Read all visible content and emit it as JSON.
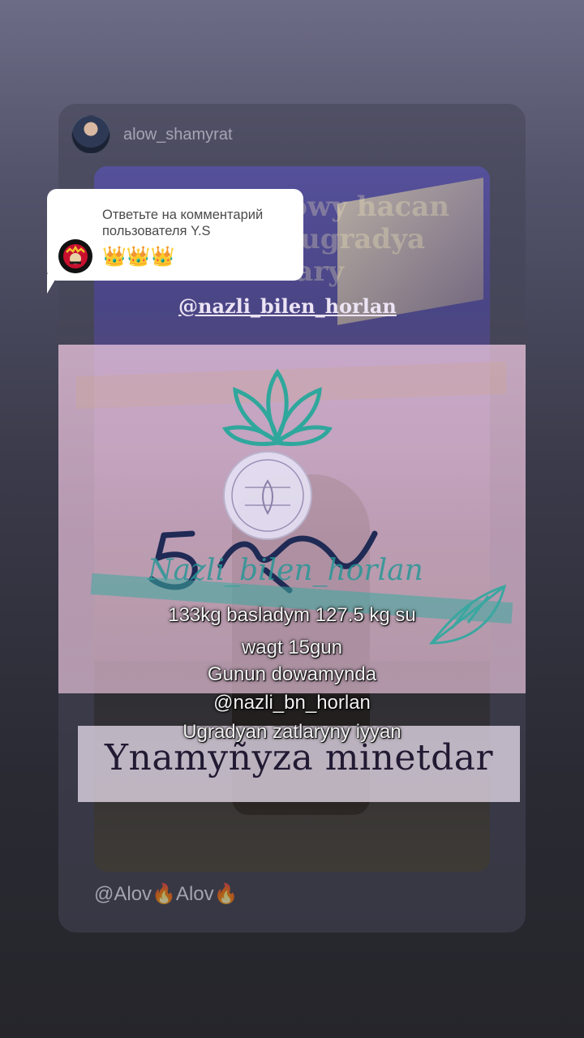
{
  "post": {
    "username": "alow_shamyrat",
    "footer": "@Alov🔥Alov🔥"
  },
  "reply_bubble": {
    "title": "Ответьте на комментарий пользователя Y.S",
    "comment": "👑👑👑"
  },
  "video": {
    "top_lines": [
      "owy hacan",
      "ugradya",
      "ary"
    ],
    "top_handle": "@nazli_bilen_horlan",
    "bag_brand": "Nazli_bilen_horlan",
    "captions": [
      "133kg basladym 127.5 kg su",
      "wagt 15gun",
      "Gunun dowamynda",
      "@nazli_bn_horlan",
      "Ugradyan zatlaryny iyyan"
    ],
    "banner": "Ynamyñyza minetdar"
  },
  "colors": {
    "accent_teal": "#3aa7a0",
    "bag_pink": "#f0c6df",
    "banner_text": "#221a33"
  }
}
